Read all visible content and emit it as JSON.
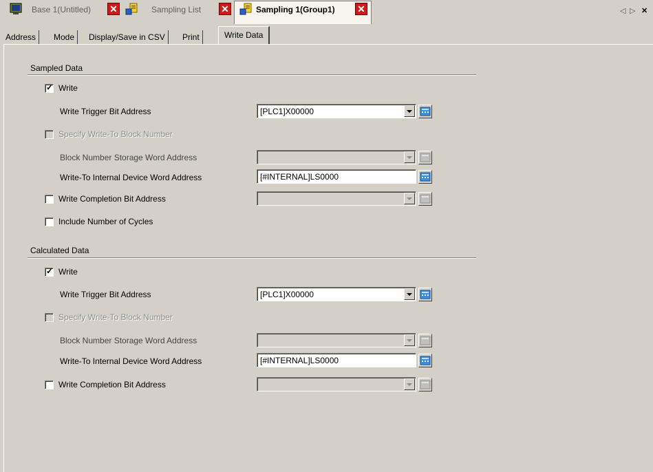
{
  "doc_tabs": [
    {
      "label": "Base 1(Untitled)",
      "icon": "screen-icon",
      "active": false
    },
    {
      "label": "Sampling List",
      "icon": "sampling-icon",
      "active": false
    },
    {
      "label": "Sampling 1(Group1)",
      "icon": "sampling-icon",
      "active": true
    }
  ],
  "doc_close_glyph": "✕",
  "nav": {
    "prev": "◁",
    "next": "▷",
    "close": "✕"
  },
  "prop_tabs": [
    "Address",
    "Mode",
    "Display/Save in CSV",
    "Print",
    "Write Data"
  ],
  "active_prop_tab": "Write Data",
  "sampled": {
    "title": "Sampled Data",
    "write": {
      "label": "Write",
      "checked": true
    },
    "trigger": {
      "label": "Write Trigger Bit Address",
      "value": "[PLC1]X00000"
    },
    "specify_block": {
      "label": "Specify Write-To Block Number",
      "checked": false,
      "enabled": false
    },
    "block_storage": {
      "label": "Block Number Storage Word Address",
      "value": "",
      "enabled": false
    },
    "internal_device": {
      "label": "Write-To Internal Device Word Address",
      "value": "[#INTERNAL]LS0000"
    },
    "completion": {
      "label": "Write Completion Bit Address",
      "checked": false,
      "value": ""
    },
    "cycles": {
      "label": "Include Number of Cycles",
      "checked": false
    }
  },
  "calculated": {
    "title": "Calculated Data",
    "write": {
      "label": "Write",
      "checked": true
    },
    "trigger": {
      "label": "Write Trigger Bit Address",
      "value": "[PLC1]X00000"
    },
    "specify_block": {
      "label": "Specify Write-To Block Number",
      "checked": false,
      "enabled": false
    },
    "block_storage": {
      "label": "Block Number Storage Word Address",
      "value": "",
      "enabled": false
    },
    "internal_device": {
      "label": "Write-To Internal Device Word Address",
      "value": "[#INTERNAL]LS0000"
    },
    "completion": {
      "label": "Write Completion Bit Address",
      "checked": false,
      "value": ""
    }
  },
  "colors": {
    "background": "#d4d0c8",
    "close_red": "#d01818",
    "keypad_blue": "#3a8fe0"
  }
}
